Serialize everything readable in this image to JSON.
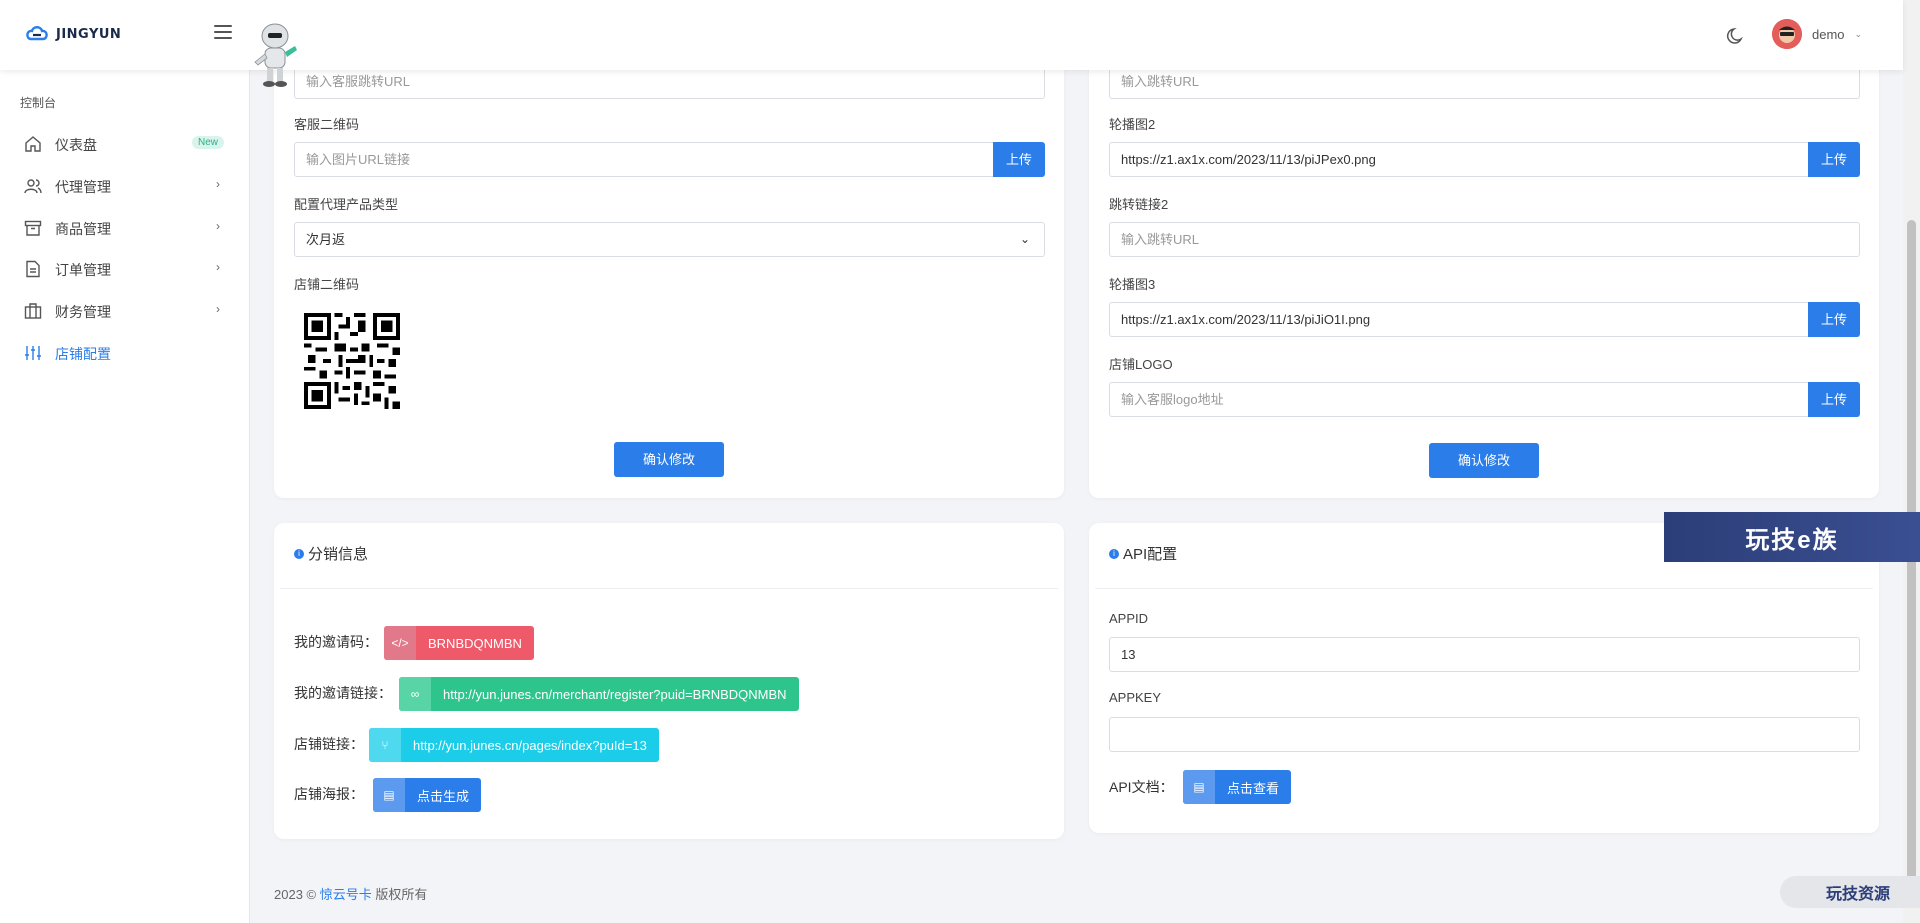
{
  "header": {
    "logo_text": "JINGYUN",
    "user_name": "demo"
  },
  "sidebar": {
    "title": "控制台",
    "items": [
      {
        "label": "仪表盘",
        "badge": "New",
        "icon": "home-icon"
      },
      {
        "label": "代理管理",
        "icon": "users-icon"
      },
      {
        "label": "商品管理",
        "icon": "archive-icon"
      },
      {
        "label": "订单管理",
        "icon": "file-text-icon"
      },
      {
        "label": "财务管理",
        "icon": "briefcase-icon"
      },
      {
        "label": "店铺配置",
        "icon": "sliders-icon"
      }
    ]
  },
  "left_form": {
    "service_url_placeholder": "输入客服跳转URL",
    "service_qr_label": "客服二维码",
    "service_qr_placeholder": "输入图片URL链接",
    "upload_label": "上传",
    "product_type_label": "配置代理产品类型",
    "product_type_value": "次月返",
    "shop_qr_label": "店铺二维码",
    "confirm_label": "确认修改"
  },
  "right_form": {
    "jump_url_placeholder": "输入跳转URL",
    "carousel2_label": "轮播图2",
    "carousel2_value": "https://z1.ax1x.com/2023/11/13/piJPex0.png",
    "jump2_label": "跳转链接2",
    "jump2_placeholder": "输入跳转URL",
    "carousel3_label": "轮播图3",
    "carousel3_value": "https://z1.ax1x.com/2023/11/13/piJiO1I.png",
    "logo_label": "店铺LOGO",
    "logo_placeholder": "输入客服logo地址",
    "upload_label": "上传",
    "confirm_label": "确认修改"
  },
  "distribution": {
    "title": "分销信息",
    "invite_code_label": "我的邀请码：",
    "invite_code": "BRNBDQNMBN",
    "invite_link_label": "我的邀请链接：",
    "invite_link": "http://yun.junes.cn/merchant/register?puid=BRNBDQNMBN",
    "shop_link_label": "店铺链接：",
    "shop_link": "http://yun.junes.cn/pages/index?puId=13",
    "poster_label": "店铺海报：",
    "poster_button": "点击生成"
  },
  "api": {
    "title": "API配置",
    "appid_label": "APPID",
    "appid_value": "13",
    "appkey_label": "APPKEY",
    "appkey_value": "",
    "doc_label": "API文档：",
    "doc_button": "点击查看"
  },
  "footer": {
    "prefix": "2023 ©",
    "brand": "惊云号卡",
    "suffix": "版权所有"
  },
  "watermarks": {
    "banner": "玩技e族",
    "bottom": "玩技资源"
  },
  "colors": {
    "primary": "#2b7de9",
    "red_pill": "#ef5a6a",
    "green_pill": "#2ec58d",
    "cyan_pill": "#1bcde8"
  }
}
